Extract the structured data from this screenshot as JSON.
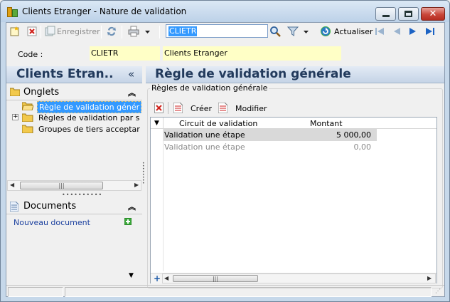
{
  "window": {
    "title": "Clients Etranger -  Nature de validation"
  },
  "toolbar": {
    "save_label": "Enregistrer",
    "search_value": "CLIETR",
    "refresh_label": "Actualiser"
  },
  "record": {
    "code_label": "Code :",
    "code_value": "CLIETR",
    "name_value": "Clients Etranger"
  },
  "left_panel": {
    "title": "Clients Etran..",
    "collapse_glyph": "«",
    "tabs_section": {
      "label": "Onglets",
      "items": [
        {
          "label": "Règle de validation génér",
          "selected": true,
          "expandable": false
        },
        {
          "label": "Règles de validation par s",
          "selected": false,
          "expandable": true
        },
        {
          "label": "Groupes de tiers acceptar",
          "selected": false,
          "expandable": false
        }
      ]
    },
    "documents_section": {
      "label": "Documents",
      "new_document_label": "Nouveau document"
    }
  },
  "right_panel": {
    "title": "Règle de validation générale",
    "group_title": "Règles de validation générale",
    "grid_toolbar": {
      "create_label": "Créer",
      "modify_label": "Modifier"
    },
    "grid": {
      "columns": [
        "Circuit de validation",
        "Montant"
      ],
      "rows": [
        {
          "circuit": "Validation une étape",
          "montant": "5 000,00",
          "state": "active"
        },
        {
          "circuit": "Validation une étape",
          "montant": "0,00",
          "state": "ghost"
        }
      ]
    }
  },
  "colors": {
    "header_text": "#223a5c",
    "selection": "#3399ff",
    "input_highlight": "#ffffc6",
    "link": "#1a3f9e"
  }
}
